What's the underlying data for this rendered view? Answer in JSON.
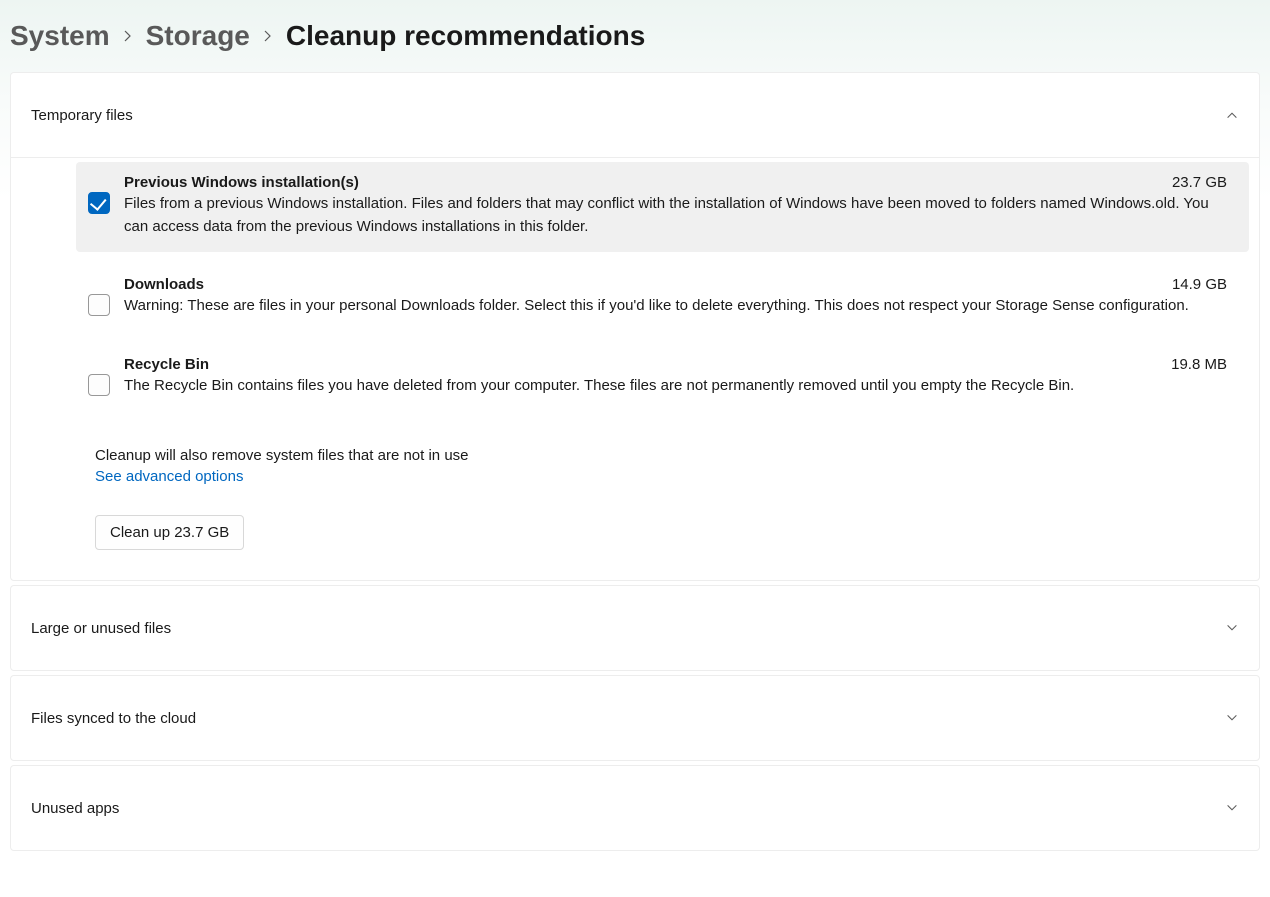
{
  "breadcrumb": {
    "part1": "System",
    "part2": "Storage",
    "current": "Cleanup recommendations"
  },
  "sections": {
    "temporary_files": {
      "title": "Temporary files",
      "expanded": true,
      "items": [
        {
          "title": "Previous Windows installation(s)",
          "size": "23.7 GB",
          "description": "Files from a previous Windows installation.  Files and folders that may conflict with the installation of Windows have been moved to folders named Windows.old.  You can access data from the previous Windows installations in this folder.",
          "checked": true
        },
        {
          "title": "Downloads",
          "size": "14.9 GB",
          "description": "Warning: These are files in your personal Downloads folder. Select this if you'd like to delete everything. This does not respect your Storage Sense configuration.",
          "checked": false
        },
        {
          "title": "Recycle Bin",
          "size": "19.8 MB",
          "description": "The Recycle Bin contains files you have deleted from your computer. These files are not permanently removed until you empty the Recycle Bin.",
          "checked": false
        }
      ],
      "note": "Cleanup will also remove system files that are not in use",
      "advanced_link": "See advanced options",
      "button_label": "Clean up 23.7 GB"
    },
    "large_unused": {
      "title": "Large or unused files",
      "expanded": false
    },
    "synced_cloud": {
      "title": "Files synced to the cloud",
      "expanded": false
    },
    "unused_apps": {
      "title": "Unused apps",
      "expanded": false
    }
  }
}
